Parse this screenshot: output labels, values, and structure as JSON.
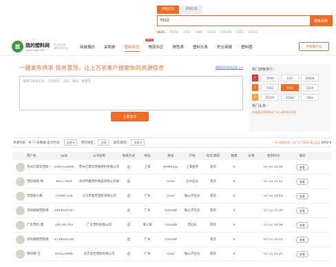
{
  "search": {
    "tabs": [
      "供给信息",
      "求购信息"
    ],
    "value": "5502",
    "button": "搜索采购",
    "hot_keys": [
      "0035",
      "H5500",
      "2520",
      "4900",
      "5502E",
      "5502EN",
      "5505",
      "H5502"
    ]
  },
  "logo": {
    "mark": "塑",
    "title": "我的塑料网",
    "domain": "www.51pla.com",
    "slogan_1": "专业供应链",
    "slogan_2": "塑料交易平台"
  },
  "nav": {
    "items": [
      "商城报价",
      "采购单",
      "塑料资讯",
      "物流专区",
      "物性表",
      "塑料头条",
      "积分商城",
      "塑料圈"
    ],
    "active_index": 2,
    "new_badge": "NEW",
    "app_button": "手机看产品"
  },
  "publish": {
    "title": "一键发布供求 信息置顶，让上万名客户搜索你的资源信息",
    "link": "塑塑同步发布记录 >>",
    "placeholder": "请填写采购信息，包括原料、品牌、牌号、数量等",
    "button": "立即发布"
  },
  "hot": {
    "title": "热门搜索排行：",
    "ranks": [
      {
        "num": "1",
        "items": [
          "7000f",
          "b10",
          "5000S"
        ]
      },
      {
        "num": "2",
        "items": [
          "7042",
          "5502",
          "2119"
        ]
      },
      {
        "num": "3",
        "items": [
          "2426h",
          "218wj",
          "180s"
        ]
      }
    ],
    "highlight": "5502",
    "sub_title": "热门头条：",
    "tag": "中油燕山HDPE出厂价上调100元/吨"
  },
  "filter": {
    "label": "资源列表",
    "prefix": "共",
    "count": "22",
    "suffix": "条数据 显示时间：",
    "time": "全部",
    "area_label": "所在地区：",
    "area": "全部",
    "mode_label": "现货/期货：",
    "mode": "全部",
    "notice_prefix": "广州 求购信息：出厂价 5502 燕山石化",
    "notice_price": "9450 0"
  },
  "table": {
    "headers": [
      "用户名",
      "qq号",
      "公司名称",
      "联系方式",
      "地址",
      "牌号",
      "产地",
      "现货/期货",
      "数量",
      "价格",
      "更新时间",
      "操作"
    ],
    "rows": [
      {
        "user": "苏州亿建华塑胶—张",
        "qq": "2397114806",
        "company": "苏州亿建华塑胶原料有限公司",
        "loc": "上海",
        "grade": "HHM5502",
        "prod": "上海金菲",
        "type": "现货",
        "qty": "0",
        "time": "07-11 15:56",
        "op": "查看"
      },
      {
        "user": "塑料采购-杨",
        "qq": "80177854",
        "company": "深圳市嘉塑料制品有限公司采",
        "loc": "",
        "grade": "5502",
        "prod": "兰州石化",
        "type": "现货",
        "qty": "0",
        "time": "07-11 15:51",
        "op": "查看"
      },
      {
        "user": "茂塑胶小黄",
        "qq": "729007156",
        "company": "义乌市金茂塑胶有限公司",
        "loc": "广州",
        "grade": "5502",
        "prod": "独山子石化",
        "type": "现货",
        "qty": "0",
        "time": "07-11 15:43",
        "op": "查看"
      },
      {
        "user": "深圳通福塑胶胡",
        "qq": "2943614147",
        "company": "",
        "loc": "广州",
        "grade": "5502LW",
        "prod": "独山子石化",
        "type": "现货",
        "qty": "0",
        "time": "07-11 15:30",
        "op": "查看"
      },
      {
        "user": "广东塑料-唐",
        "qq": "245797763",
        "company": "广东塑料有限公司",
        "loc": "珠三角",
        "grade": "5502LW",
        "prod": "茂石化",
        "type": "现货",
        "qty": "0",
        "time": "07-11 14:56",
        "op": "查看"
      },
      {
        "user": "深圳通福塑胶胡",
        "qq": "2758016136",
        "company": "",
        "loc": "广州",
        "grade": "5502LW",
        "prod": "",
        "type": "现货",
        "qty": "0",
        "time": "07-11 15:25",
        "op": "查看"
      },
      {
        "user": "塑料网-王",
        "qq": "879123066",
        "company": "北京昌佳塑胶有限公司",
        "loc": "广州",
        "grade": "5502",
        "prod": "独山子石化",
        "type": "现货",
        "qty": "0",
        "time": "07-11 15:25",
        "op": "查看"
      }
    ]
  },
  "colors": {
    "accent": "#f26b22",
    "brand": "#3a9b3a"
  },
  "icons": {
    "phone": "phone-icon"
  }
}
